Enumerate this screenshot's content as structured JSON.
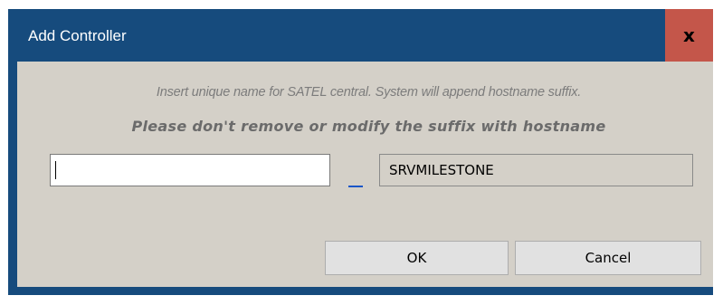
{
  "window": {
    "title": "Add Controller",
    "close_label": "x"
  },
  "dialog": {
    "hint_line1": "Insert unique name for SATEL central. System will append hostname suffix.",
    "hint_line2": "Please don't remove or modify the suffix with hostname",
    "name_value": "",
    "separator_glyph": "_",
    "suffix_value": "SRVMILESTONE"
  },
  "buttons": {
    "ok_label": "OK",
    "cancel_label": "Cancel"
  },
  "colors": {
    "titlebar": "#164b7d",
    "close_button": "#c4564a",
    "client": "#d4d0c8",
    "hint_text": "#7c7c7c"
  }
}
